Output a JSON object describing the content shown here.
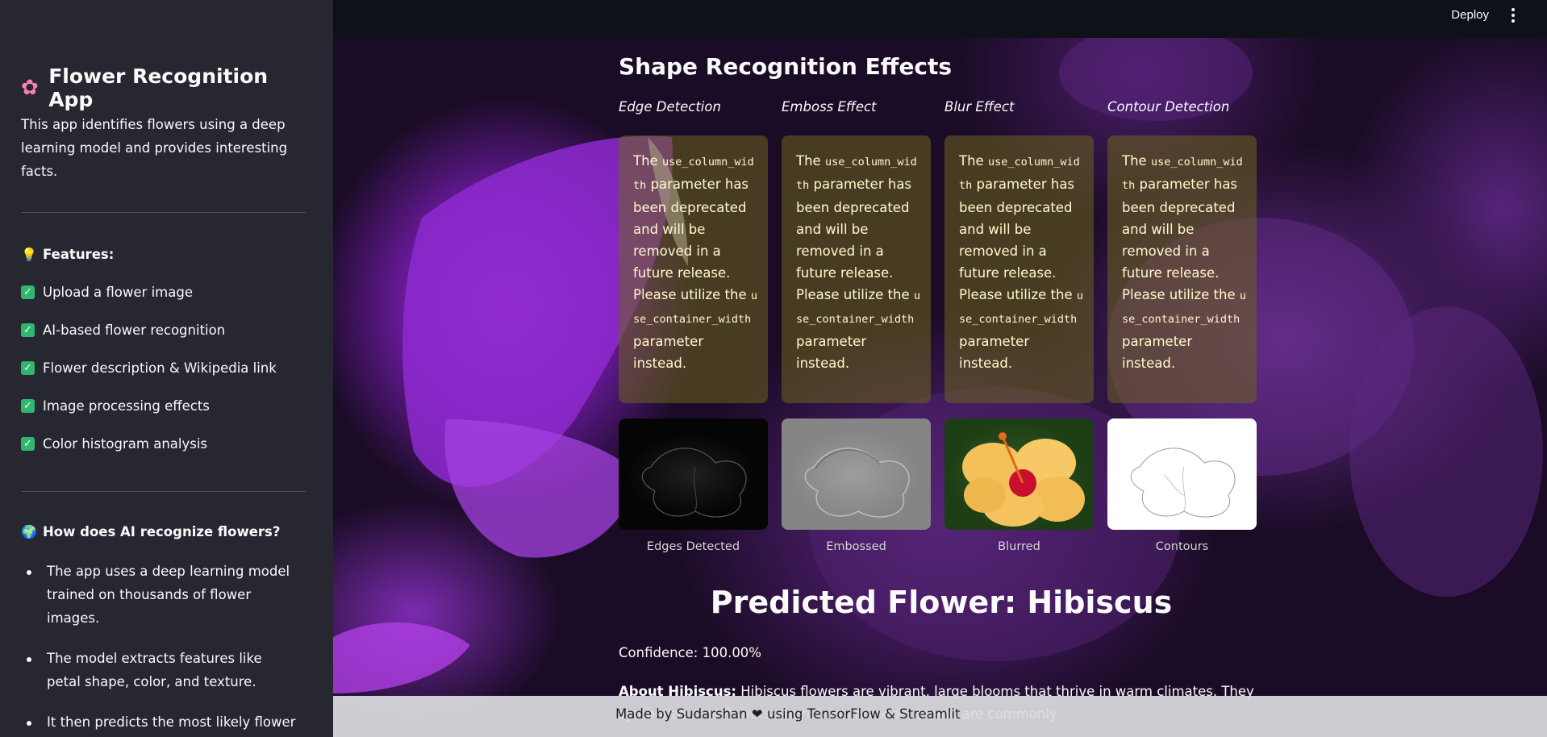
{
  "sidebar": {
    "app_icon": "cherry-blossom-icon",
    "title": "Flower Recognition App",
    "description": "This app identifies flowers using a deep learning model and provides interesting facts.",
    "features_heading": "Features:",
    "features_icon": "light-bulb-icon",
    "features": [
      "Upload a flower image",
      "AI-based flower recognition",
      "Flower description & Wikipedia link",
      "Image processing effects",
      "Color histogram analysis"
    ],
    "how_heading": "How does AI recognize flowers?",
    "how_icon": "globe-icon",
    "how_points": [
      "The app uses a deep learning model trained on thousands of flower images.",
      "The model extracts features like petal shape, color, and texture.",
      "It then predicts the most likely flower species."
    ]
  },
  "topbar": {
    "deploy_label": "Deploy",
    "menu_icon": "vertical-ellipsis-icon"
  },
  "main": {
    "section_title": "Shape Recognition Effects",
    "columns": [
      {
        "label": "Edge Detection",
        "warning": {
          "pre": "The ",
          "code1": "use_column_width",
          "mid": " parameter has been deprecated and will be removed in a future release. Please utilize the ",
          "code2": "use_container_width",
          "post": " parameter instead."
        },
        "caption": "Edges Detected"
      },
      {
        "label": "Emboss Effect",
        "warning": {
          "pre": "The ",
          "code1": "use_column_width",
          "mid": " parameter has been deprecated and will be removed in a future release. Please utilize the ",
          "code2": "use_container_width",
          "post": " parameter instead."
        },
        "caption": "Embossed"
      },
      {
        "label": "Blur Effect",
        "warning": {
          "pre": "The ",
          "code1": "use_column_width",
          "mid": " parameter has been deprecated and will be removed in a future release. Please utilize the ",
          "code2": "use_container_width",
          "post": " parameter instead."
        },
        "caption": "Blurred"
      },
      {
        "label": "Contour Detection",
        "warning": {
          "pre": "The ",
          "code1": "use_column_width",
          "mid": " parameter has been deprecated and will be removed in a future release. Please utilize the ",
          "code2": "use_container_width",
          "post": " parameter instead."
        },
        "caption": "Contours"
      }
    ],
    "predicted": "Predicted Flower: Hibiscus",
    "confidence": "Confidence: 100.00%",
    "about_label": "About Hibiscus:",
    "about_text": " Hibiscus flowers are vibrant, large blooms that thrive in warm climates. They symbolize ... al flowers are rich in antioxidants and are commonly"
  },
  "footer": {
    "pre": "Made by Sudarshan ",
    "heart_icon": "heart-icon",
    "heart": "❤",
    "post": " using TensorFlow & Streamlit"
  }
}
